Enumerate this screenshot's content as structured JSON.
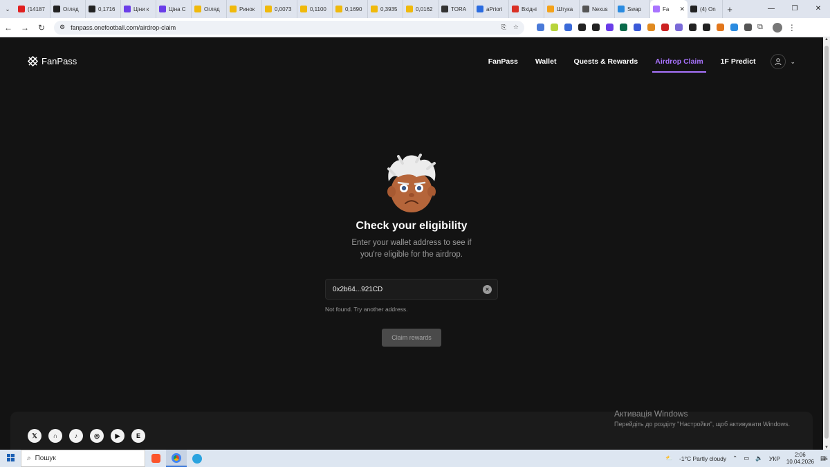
{
  "browser": {
    "tabs": [
      {
        "label": "(14187",
        "color": "#e02020"
      },
      {
        "label": "Огляд",
        "color": "#222222"
      },
      {
        "label": "0,1716",
        "color": "#222222"
      },
      {
        "label": "Ціни к",
        "color": "#6a3de8"
      },
      {
        "label": "Ціна С",
        "color": "#6a3de8"
      },
      {
        "label": "Огляд",
        "color": "#f0b90b"
      },
      {
        "label": "Ринок",
        "color": "#f0b90b"
      },
      {
        "label": "0,0073",
        "color": "#f0b90b"
      },
      {
        "label": "0,1100",
        "color": "#f0b90b"
      },
      {
        "label": "0,1690",
        "color": "#f0b90b"
      },
      {
        "label": "0,3935",
        "color": "#f0b90b"
      },
      {
        "label": "0,0162",
        "color": "#f0b90b"
      },
      {
        "label": "TORA",
        "color": "#333333"
      },
      {
        "label": "aPriori",
        "color": "#2a6be0"
      },
      {
        "label": "Вхідні",
        "color": "#d93025"
      },
      {
        "label": "Штука",
        "color": "#f4a21a"
      },
      {
        "label": "Nexus",
        "color": "#555555"
      },
      {
        "label": "Swap",
        "color": "#2a8be0"
      },
      {
        "label": "Fa",
        "color": "#a974ff",
        "active": true
      },
      {
        "label": "(4) On",
        "color": "#222222"
      }
    ],
    "url": "fanpass.onefootball.com/airdrop-claim",
    "extension_colors": [
      "#4a7ad8",
      "#b8d43a",
      "#3a6ad8",
      "#222222",
      "#222222",
      "#6a3de8",
      "#0a6a4a",
      "#3a5ad8",
      "#e08a20",
      "#cc2222",
      "#7a6ad8",
      "#222222",
      "#222222",
      "#e2761b",
      "#2a8be0",
      "#555555"
    ]
  },
  "header": {
    "logo_text": "FanPass",
    "nav": [
      {
        "label": "FanPass",
        "active": false
      },
      {
        "label": "Wallet",
        "active": false
      },
      {
        "label": "Quests & Rewards",
        "active": false
      },
      {
        "label": "Airdrop Claim",
        "active": true
      },
      {
        "label": "1F Predict",
        "active": false
      }
    ]
  },
  "main": {
    "title": "Check your eligibility",
    "subtitle": "Enter your wallet address to see if you're eligible for the airdrop.",
    "wallet_value": "0x2b64...921CD",
    "status_message": "Not found. Try another address.",
    "claim_label": "Claim rewards"
  },
  "footer": {
    "socials": [
      {
        "icon": "x-icon",
        "glyph": "𝕏"
      },
      {
        "icon": "threads-icon",
        "glyph": "∩"
      },
      {
        "icon": "tiktok-icon",
        "glyph": "♪"
      },
      {
        "icon": "instagram-icon",
        "glyph": "◎"
      },
      {
        "icon": "youtube-icon",
        "glyph": "▶"
      },
      {
        "icon": "tumblr-icon",
        "glyph": "E"
      }
    ]
  },
  "watermark": {
    "line1": "Активація Windows",
    "line2": "Перейдіть до розділу \"Настройки\", щоб активувати Windows."
  },
  "taskbar": {
    "search_text": "Пошук",
    "weather": "-1°C  Partly cloudy",
    "language": "УКР",
    "time": "2:06",
    "date": "10.04.2026",
    "notifications": "15"
  },
  "colors": {
    "accent": "#a974ff",
    "page_bg": "#131313"
  }
}
